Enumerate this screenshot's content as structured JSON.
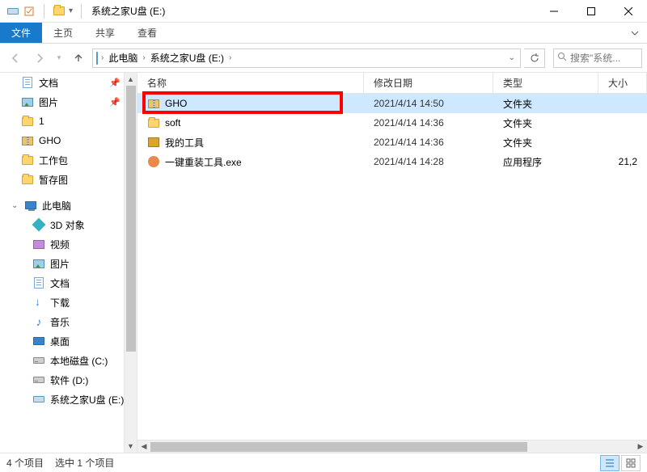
{
  "titlebar": {
    "title": "系统之家U盘 (E:)"
  },
  "ribbon": {
    "file": "文件",
    "home": "主页",
    "share": "共享",
    "view": "查看"
  },
  "breadcrumb": {
    "root": "此电脑",
    "current": "系统之家U盘 (E:)"
  },
  "search": {
    "placeholder": "搜索\"系统..."
  },
  "sidebar": {
    "quick": [
      {
        "label": "文档",
        "pinned": true,
        "icon": "doc"
      },
      {
        "label": "图片",
        "pinned": true,
        "icon": "pic"
      },
      {
        "label": "1",
        "pinned": false,
        "icon": "folder"
      },
      {
        "label": "GHO",
        "pinned": false,
        "icon": "zip"
      },
      {
        "label": "工作包",
        "pinned": false,
        "icon": "folder"
      },
      {
        "label": "暂存图",
        "pinned": false,
        "icon": "folder"
      }
    ],
    "pc_label": "此电脑",
    "pc_items": [
      {
        "label": "3D 对象",
        "icon": "obj3d"
      },
      {
        "label": "视频",
        "icon": "vid"
      },
      {
        "label": "图片",
        "icon": "pic"
      },
      {
        "label": "文档",
        "icon": "doc"
      },
      {
        "label": "下载",
        "icon": "dl"
      },
      {
        "label": "音乐",
        "icon": "mus"
      },
      {
        "label": "桌面",
        "icon": "desk"
      },
      {
        "label": "本地磁盘 (C:)",
        "icon": "drive"
      },
      {
        "label": "软件 (D:)",
        "icon": "drive"
      },
      {
        "label": "系统之家U盘 (E:)",
        "icon": "usb"
      }
    ]
  },
  "columns": {
    "name": "名称",
    "date": "修改日期",
    "type": "类型",
    "size": "大小"
  },
  "rows": [
    {
      "name": "GHO",
      "date": "2021/4/14 14:50",
      "type": "文件夹",
      "size": "",
      "icon": "zip",
      "selected": true,
      "highlighted": true
    },
    {
      "name": "soft",
      "date": "2021/4/14 14:36",
      "type": "文件夹",
      "size": "",
      "icon": "folder",
      "selected": false
    },
    {
      "name": "我的工具",
      "date": "2021/4/14 14:36",
      "type": "文件夹",
      "size": "",
      "icon": "tool",
      "selected": false
    },
    {
      "name": "一键重装工具.exe",
      "date": "2021/4/14 14:28",
      "type": "应用程序",
      "size": "21,2",
      "icon": "exe",
      "selected": false
    }
  ],
  "status": {
    "count": "4 个项目",
    "selected": "选中 1 个项目"
  }
}
